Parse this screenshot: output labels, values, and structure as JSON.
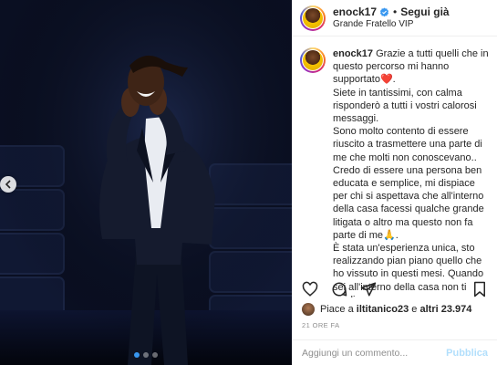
{
  "post": {
    "username": "enock17",
    "follow_label": "Segui già",
    "separator": "•",
    "location": "Grande Fratello VIP"
  },
  "caption": {
    "username": "enock17",
    "lines": [
      "Grazie a tutti quelli che in questo percorso mi hanno supportato❤️.",
      "Siete in tantissimi, con calma risponderò a tutti i vostri calorosi messaggi.",
      "Sono molto contento di essere riuscito a trasmettere una parte di me che molti non conoscevano..",
      "Credo di essere una persona ben educata e semplice, mi dispiace per chi si aspettava che all'interno della casa facessi qualche grande litigata o altro ma questo non fa parte di me🙏.",
      "È stata un'esperienza unica, sto realizzando pian piano quello che ho vissuto in questi mesi. Quando sei all'interno della casa non ti rendi"
    ]
  },
  "likes": {
    "prefix": "Piace a",
    "user": "iltitanico23",
    "connector": "e",
    "others": "altri 23.974"
  },
  "time_ago": "21 ORE FA",
  "comment": {
    "placeholder": "Aggiungi un commento...",
    "publish_label": "Pubblica"
  },
  "carousel": {
    "count": 3,
    "active_index": 0
  },
  "icons": {
    "verified": "verified-badge-icon",
    "like": "heart-icon",
    "comment": "comment-bubble-icon",
    "share": "paper-plane-icon",
    "save": "bookmark-icon",
    "prev": "chevron-left-icon",
    "emoji": "smiley-icon"
  },
  "colors": {
    "verified_blue": "#3897f0",
    "publish_disabled": "#b2dffc",
    "muted_text": "#8e8e8e"
  }
}
